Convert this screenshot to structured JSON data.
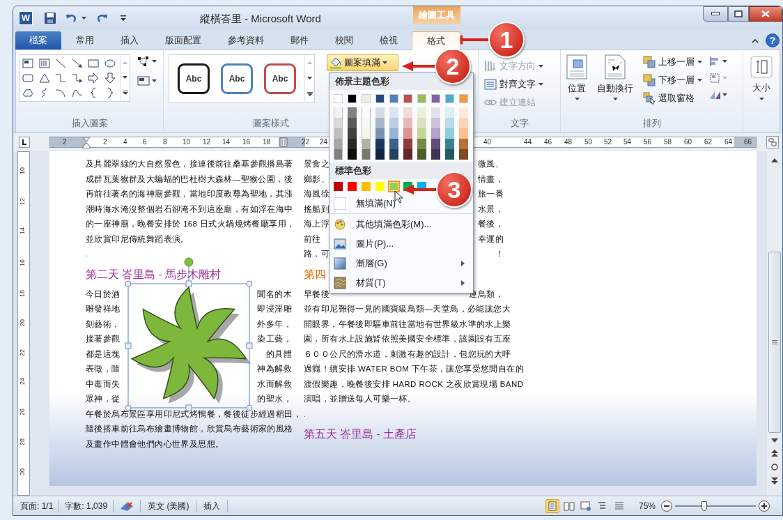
{
  "window": {
    "app_logo": "W",
    "title": "縱橫峇里 - Microsoft Word",
    "contextual_tab": "繪圖工具"
  },
  "tabs": [
    {
      "label": "檔案",
      "kind": "file",
      "selected": false
    },
    {
      "label": "常用",
      "kind": "tab",
      "selected": false
    },
    {
      "label": "插入",
      "kind": "tab",
      "selected": false
    },
    {
      "label": "版面配置",
      "kind": "tab",
      "selected": false
    },
    {
      "label": "參考資料",
      "kind": "tab",
      "selected": false
    },
    {
      "label": "郵件",
      "kind": "tab",
      "selected": false
    },
    {
      "label": "校閱",
      "kind": "tab",
      "selected": false
    },
    {
      "label": "檢視",
      "kind": "tab",
      "selected": false
    },
    {
      "label": "格式",
      "kind": "tab",
      "selected": true
    }
  ],
  "help": "?",
  "ribbon": {
    "group_labels": [
      "插入圖案",
      "圖案樣式",
      "文字",
      "排列"
    ],
    "shape_styles": [
      {
        "label": "Abc",
        "color": "#1a1a1a"
      },
      {
        "label": "Abc",
        "color": "#4f81bd"
      },
      {
        "label": "Abc",
        "color": "#c0504d"
      }
    ],
    "fill_button": "圖案填滿",
    "text_commands": [
      {
        "label": "文字方向",
        "disabled": true
      },
      {
        "label": "對齊文字",
        "disabled": false
      },
      {
        "label": "建立連結",
        "disabled": true
      }
    ],
    "arrange_large": [
      "位置",
      "自動換行"
    ],
    "arrange_small": [
      "上移一層",
      "下移一層",
      "選取窗格"
    ],
    "size_button": "大小"
  },
  "fill_menu": {
    "theme_heading": "佈景主題色彩",
    "theme_colors": [
      {
        "color": "#ffffff"
      },
      {
        "color": "#000000"
      },
      {
        "color": "#eeece1"
      },
      {
        "color": "#1f497d"
      },
      {
        "color": "#4f81bd"
      },
      {
        "color": "#c0504d"
      },
      {
        "color": "#9bbb59"
      },
      {
        "color": "#8064a2"
      },
      {
        "color": "#4bacc6"
      },
      {
        "color": "#f79646"
      }
    ],
    "standard_heading": "標準色彩",
    "standard_colors": [
      {
        "color": "#c00000",
        "selected": false
      },
      {
        "color": "#ff0000",
        "selected": false
      },
      {
        "color": "#ffc000",
        "selected": false
      },
      {
        "color": "#ffff00",
        "selected": false
      },
      {
        "color": "#92d050",
        "selected": true
      },
      {
        "color": "#00b050",
        "selected": false
      },
      {
        "color": "#00b0f0",
        "selected": false
      }
    ],
    "items": [
      {
        "label": "無填滿(N)",
        "kind": "nofill"
      },
      {
        "label": "其他填滿色彩(M)...",
        "kind": "more",
        "submenu": false
      },
      {
        "label": "圖片(P)...",
        "kind": "picture",
        "submenu": false
      },
      {
        "label": "漸層(G)",
        "kind": "gradient",
        "submenu": true
      },
      {
        "label": "材質(T)",
        "kind": "texture",
        "submenu": true
      }
    ]
  },
  "ruler": {
    "numbers": [
      "2",
      "2",
      "4",
      "6",
      "8",
      "10",
      "12",
      "14",
      "16",
      "18",
      "22",
      "24",
      "40",
      "44",
      "46",
      "48",
      "50",
      "52",
      "54",
      "56",
      "58",
      "60",
      "62",
      "64",
      "66"
    ],
    "vertical_numbers": [
      "10",
      "12",
      "14",
      "16",
      "18",
      "20",
      "22",
      "24",
      "26",
      "28",
      "30"
    ]
  },
  "document": {
    "columns": [
      {
        "blocks": [
          {
            "kind": "paragraph",
            "lines": [
              [
                "及具麗翠綠的大自然景色，接連後前往桑基參觀播島著"
              ],
              [
                "成群瓦葉猴群及大蝙蝠的巴杜樹大森林—聖猴公園，後"
              ],
              [
                "再前往著名的海神廟參觀，當地印度教尊為聖地，其漲"
              ],
              [
                "潮時海水淹沒整個岩石卻淹不到這座廟，有如浮在海中"
              ],
              [
                "的一座神廟，晚餐安排於 168 日式火鍋燒烤餐廳享用，"
              ],
              [
                "並欣賞印尼傳統舞蹈表演。"
              ]
            ]
          },
          {
            "kind": "mark",
            "text": "."
          },
          {
            "kind": "heading",
            "text": "第二天 峇里島 - 馬步木雕村",
            "color": "#a0309a"
          },
          {
            "kind": "paragraph",
            "lines": [
              [
                "今日於酒",
                "聞名的木"
              ],
              [
                "雕發祥地",
                "即浸淫雕"
              ],
              [
                "刻藝術，",
                "外多年，"
              ],
              [
                "接著參觀",
                "染工藝，"
              ],
              [
                "都是這塊",
                "的具體"
              ],
              [
                "表徵，隨",
                "神為解救"
              ],
              [
                "中毒而失",
                "水而解救"
              ],
              [
                "眾神，從",
                "的聖水，"
              ],
              [
                "午餐於烏布景區享用印尼式烤鴨餐，餐後徒步經過稻田，"
              ],
              [
                "隨後搭車前往烏布繪畫博物館，欣賞烏布藝術家的風格"
              ],
              [
                "及畫作中體會他們內心世界及思想。"
              ]
            ]
          }
        ]
      },
      {
        "blocks": [
          {
            "kind": "paragraph",
            "lines": [
              [
                "景食之",
                "微風、"
              ],
              [
                "鄉影、",
                "情畫，"
              ],
              [
                "海風徐",
                "旅一番"
              ],
              [
                "搖船到",
                "水景，"
              ],
              [
                "海上浮",
                "餐後，"
              ],
              [
                "前往",
                "幸運的"
              ],
              [
                "路，可",
                "！"
              ]
            ]
          },
          {
            "kind": "heading",
            "text": "第四",
            "color": "#e36c0a"
          },
          {
            "kind": "paragraph",
            "lines": [
              [
                "早餐後",
                "連鳥類，"
              ],
              [
                "並有印尼難得一見的國寶級鳥類—天堂鳥，必能讓您大"
              ],
              [
                "開眼界，午餐後即驅車前往當地有世界級水準的水上樂"
              ],
              [
                "園，所有水上設施皆依照美國安全標準，該園設有五座"
              ],
              [
                "６００公尺的滑水道，刺激有趣的設計，包您玩的大呼"
              ],
              [
                "過癮！續安排 WATER BOM 下午茶，讓您享受悠閒自在的"
              ],
              [
                "渡假樂趣，晚餐後安排 HARD ROCK 之夜欣賞現場 BAND"
              ],
              [
                "演唱，並贈送每人可樂一杯。"
              ]
            ]
          },
          {
            "kind": "mark",
            "text": "."
          },
          {
            "kind": "heading",
            "text": "第五天 峇里島 - 土產店",
            "color": "#a0309a"
          }
        ]
      }
    ]
  },
  "status_bar": {
    "page": "頁面: 1/1",
    "words": "字數: 1,039",
    "language": "英文 (美國)",
    "mode": "插入",
    "views": [
      {
        "selected": true
      },
      {
        "selected": false
      },
      {
        "selected": false
      },
      {
        "selected": false
      },
      {
        "selected": false
      }
    ],
    "zoom": "75%",
    "zoom_slider": {
      "level": 0.35
    }
  },
  "callouts": [
    {
      "number": "1"
    },
    {
      "number": "2"
    },
    {
      "number": "3"
    }
  ]
}
